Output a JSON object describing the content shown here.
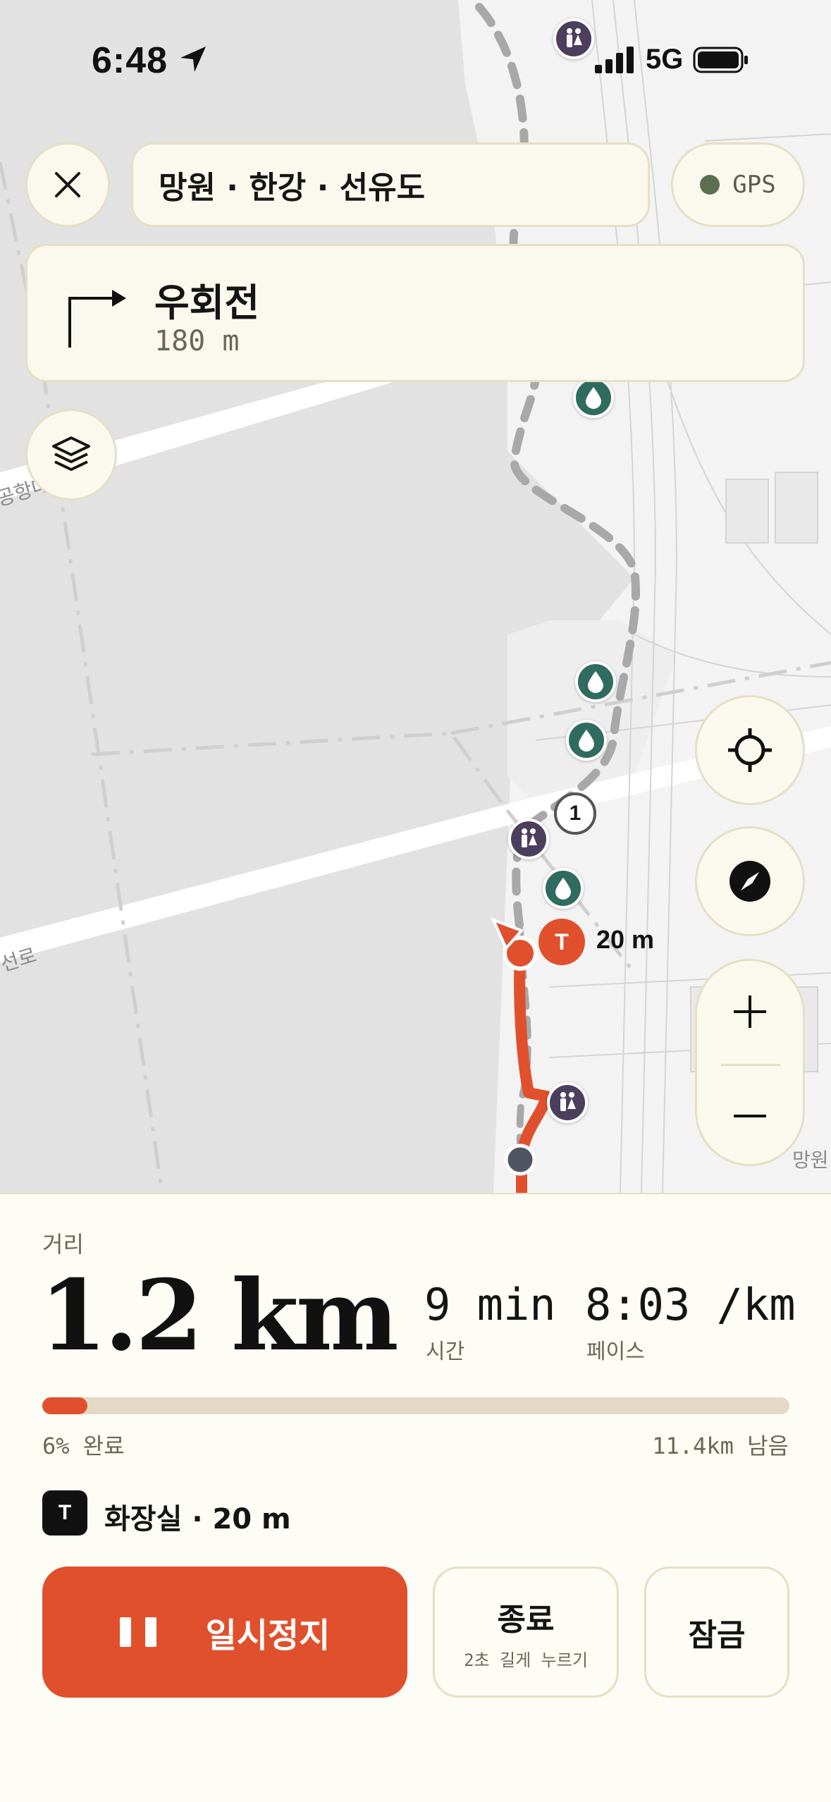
{
  "status_bar": {
    "time": "6:48",
    "network": "5G",
    "icons": [
      "location-arrow-icon",
      "signal-bars-icon",
      "battery-icon"
    ]
  },
  "top_bar": {
    "close_icon": "close-icon",
    "route_name": "망원 · 한강 · 선유도",
    "gps_label": "GPS",
    "gps_status_color": "#5b6e4f"
  },
  "turn": {
    "instruction": "우회전",
    "distance": "180 m",
    "icon": "turn-right-icon"
  },
  "map": {
    "labels": [
      "공항대",
      "선로",
      "망원"
    ],
    "waypoint_number": "1",
    "toilet_marker_letter": "T",
    "toilet_marker_distance": "20 m",
    "route_color": "#e0502c",
    "water_color": "#2f6b5f",
    "toilet_color": "#4b3f5d"
  },
  "controls": {
    "layers_icon": "layers-icon",
    "locate_icon": "crosshair-icon",
    "compass_icon": "compass-icon",
    "zoom_in_icon": "plus-icon",
    "zoom_out_icon": "minus-icon"
  },
  "stats": {
    "distance_label": "거리",
    "distance_value": "1.2 km",
    "time_value": "9 min",
    "time_label": "시간",
    "pace_value": "8:03 /km",
    "pace_label": "페이스"
  },
  "progress": {
    "fraction": 0.06,
    "completed_text": "6% 완료",
    "remaining_text": "11.4km 남음"
  },
  "next_point": {
    "badge": "T",
    "text": "화장실 · 20 m"
  },
  "actions": {
    "pause_label": "일시정지",
    "end_label": "종료",
    "end_hint": "2초 길게 누르기",
    "lock_label": "잠금"
  }
}
